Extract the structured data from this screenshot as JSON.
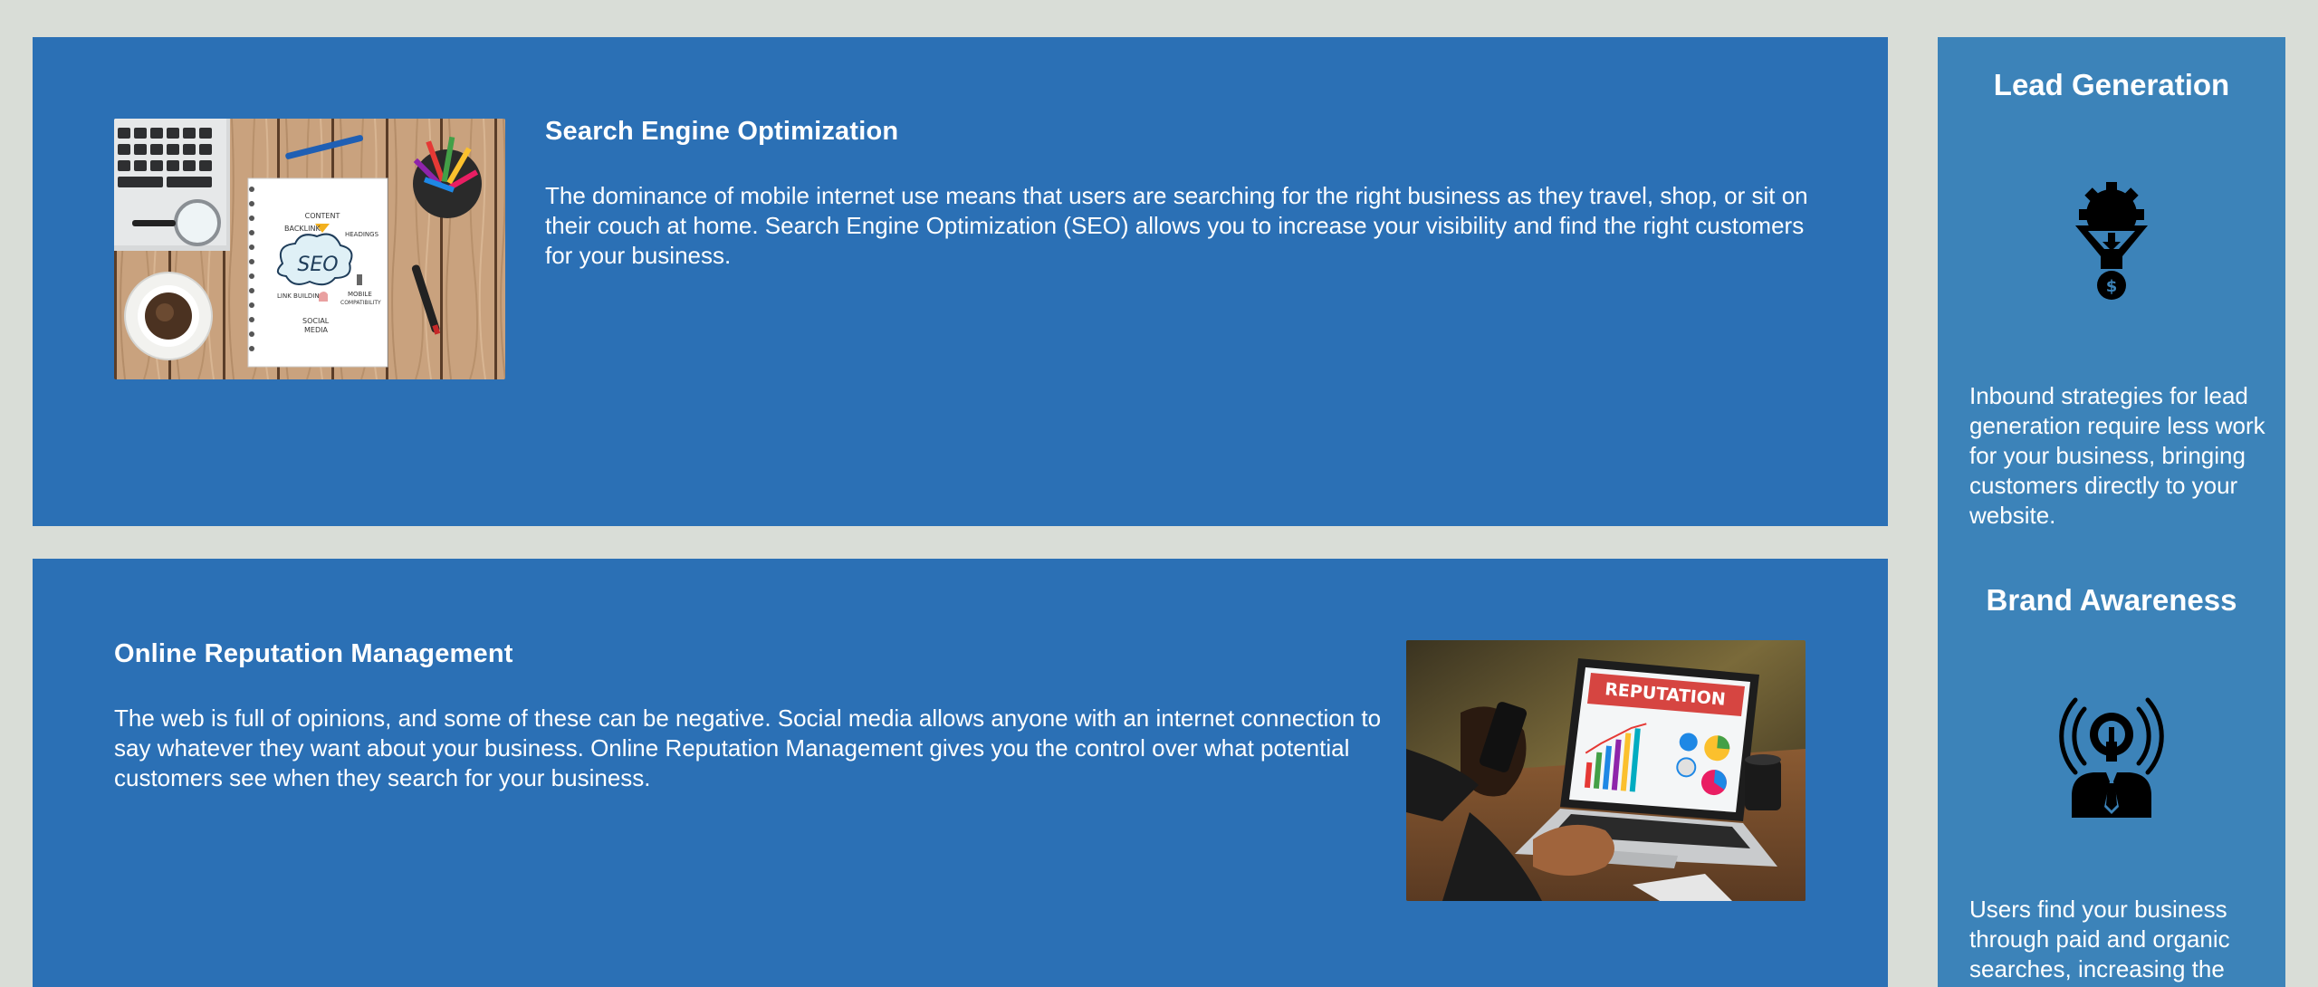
{
  "services": [
    {
      "title": "Search Engine Optimization",
      "text": "The dominance of mobile internet use means that users are searching for the right business as they travel, shop, or sit on their couch at home. Search Engine Optimization (SEO) allows you to increase your visibility and find the right customers for your business.",
      "image_icon": "seo-notebook-image",
      "image_labels": {
        "center": "SEO",
        "content": "CONTENT",
        "backlink": "BACKLINK",
        "headings": "HEADINGS",
        "link_building": "LINK BUILDING",
        "mobile": "MOBILE",
        "compatibility": "COMPATIBILITY",
        "social": "SOCIAL",
        "media": "MEDIA"
      }
    },
    {
      "title": "Online Reputation Management",
      "text": "The web is full of opinions, and some of these can be negative. Social media allows anyone with an internet connection to say whatever they want about your business. Online Reputation Management gives you the control over what potential customers see when they search for your business.",
      "image_icon": "reputation-laptop-image",
      "image_labels": {
        "screen_banner": "REPUTATION"
      }
    }
  ],
  "benefits": [
    {
      "title": "Lead Generation",
      "icon": "funnel-gear-dollar-icon",
      "text": "Inbound strategies for lead generation require less work for your business, bringing customers directly to your website."
    },
    {
      "title": "Brand Awareness",
      "icon": "lightbulb-person-icon",
      "text": "Users find your business through paid and organic searches, increasing the"
    }
  ],
  "colors": {
    "page_background": "#d9ddd7",
    "card_background": "#2b70b5",
    "sidebar_background": "#3c83b9",
    "text": "#ffffff"
  }
}
